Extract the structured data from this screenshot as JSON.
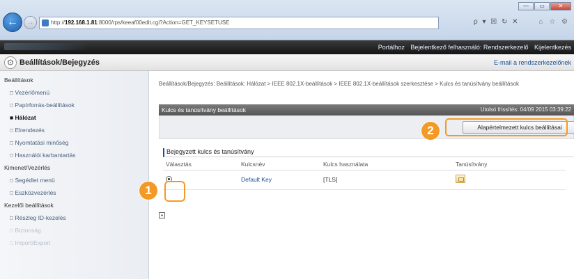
{
  "browser": {
    "url_prefix": "http://",
    "url_host": "192.168.1.81",
    "url_path": ":8000/rps/keeaf00edit.cgi?Action=GET_KEYSETUSE",
    "window_min": "—",
    "window_max": "▭",
    "window_close": "✕",
    "addr_tools": "ρ ▾ ☒ ↻ ✕",
    "right_tools": "⌂ ☆ ⚙"
  },
  "topbar": {
    "links": [
      "Portálhoz",
      "Bejelentkező felhasználó: Rendszerkezelő",
      "Kijelentkezés"
    ]
  },
  "header": {
    "title": "Beállítások/Bejegyzés",
    "mail_link": "E-mail a rendszerkezelőnek"
  },
  "sidebar": {
    "sections": [
      {
        "title": "Beállítások",
        "items": [
          {
            "label": "Vezérlőmenü"
          },
          {
            "label": "Papírforrás-beállítások"
          },
          {
            "label": "Hálózat"
          },
          {
            "label": "Elrendezés"
          },
          {
            "label": "Nyomtatási minőség"
          },
          {
            "label": "Használói karbantartás"
          }
        ]
      },
      {
        "title": "Kimenet/Vezérlés",
        "items": [
          {
            "label": "Segédlet menü"
          },
          {
            "label": "Eszközvezérlés"
          }
        ]
      },
      {
        "title": "Kezelői beállítások",
        "items": [
          {
            "label": "Részleg ID-kezelés"
          },
          {
            "label": "Biztonság"
          },
          {
            "label": "Import/Export"
          }
        ]
      }
    ]
  },
  "main": {
    "breadcrumb": "Beállítások/Bejegyzés: Beállítások: Hálózat > IEEE 802.1X-beállítások > IEEE 802.1X-beállítások szerkesztése > Kulcs és tanúsítvány beállítások",
    "cert_bar_title": "Kulcs és tanúsítvány beállítások",
    "last_updated": "Utolsó frissítés: 04/09 2015 03:39:22",
    "default_key_button": "Alapértelmezett kulcs beállításai",
    "section_title": "Bejegyzett kulcs és tanúsítvány",
    "table": {
      "headers": [
        "Választás",
        "Kulcsnév",
        "Kulcs használata",
        "Tanúsítvány"
      ],
      "rows": [
        {
          "key_name": "Default Key",
          "usage": "[TLS]"
        }
      ]
    },
    "expand_icon": "▪"
  },
  "callouts": [
    "1",
    "2"
  ],
  "colors": {
    "accent": "#f39a26",
    "link": "#1a4f95",
    "bar": "#5e5e5e"
  }
}
